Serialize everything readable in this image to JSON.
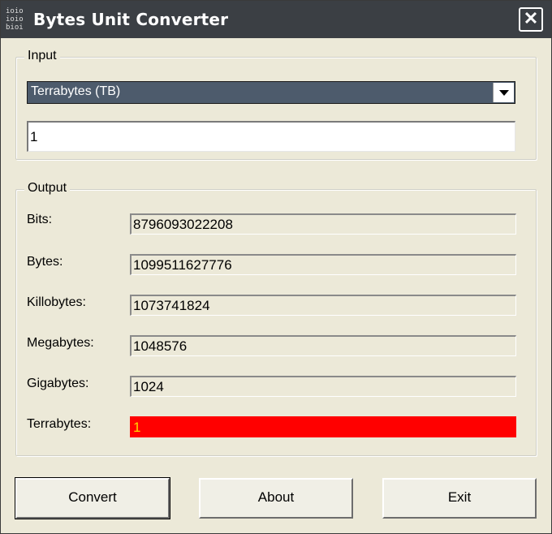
{
  "window": {
    "title": "Bytes Unit Converter",
    "app_icon_text": "ioio\nioio\nbioi",
    "close_glyph": "✕"
  },
  "input_group": {
    "legend": "Input",
    "unit_select": {
      "selected": "Terrabytes (TB)"
    },
    "value_field": {
      "value": "1"
    }
  },
  "output_group": {
    "legend": "Output",
    "rows": [
      {
        "label": "Bits:",
        "value": "8796093022208"
      },
      {
        "label": "Bytes:",
        "value": "1099511627776"
      },
      {
        "label": "Killobytes:",
        "value": "1073741824"
      },
      {
        "label": "Megabytes:",
        "value": "1048576"
      },
      {
        "label": "Gigabytes:",
        "value": "1024"
      },
      {
        "label": "Terrabytes:",
        "value": "1",
        "highlight": true,
        "highlight_color": "#ff0000"
      }
    ]
  },
  "buttons": {
    "convert": "Convert",
    "about": "About",
    "exit": "Exit"
  },
  "colors": {
    "titlebar": "#3b3f44",
    "window_bg": "#ece9d8",
    "select_bg": "#4d5b6c",
    "highlight": "#ff0000",
    "highlight_text": "#ffd700"
  }
}
